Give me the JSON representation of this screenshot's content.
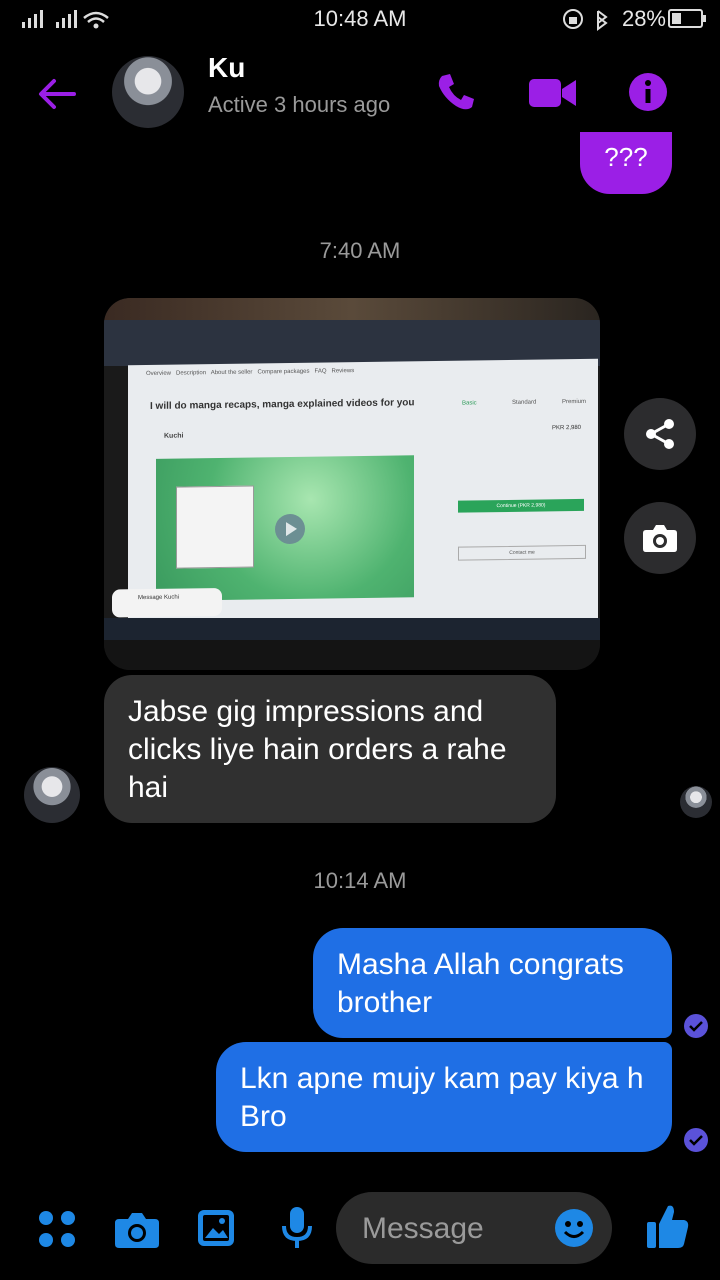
{
  "status_bar": {
    "time": "10:48 AM",
    "battery": "28%"
  },
  "header": {
    "name": "Ku",
    "presence": "Active 3 hours ago"
  },
  "messages": {
    "top_sent": "???",
    "time_1": "7:40 AM",
    "recv_1": "Jabse gig impressions and clicks liye hain orders a rahe hai",
    "time_2": "10:14 AM",
    "sent_1": "Masha Allah congrats brother",
    "sent_2": "Lkn apne mujy kam pay kiya h Bro"
  },
  "screenshot_content": {
    "gig_title": "I will do manga recaps, manga explained videos for you",
    "seller": "Kuchi",
    "tabs": [
      "Overview",
      "Description",
      "About the seller",
      "Compare packages",
      "FAQ",
      "Reviews"
    ],
    "package_tabs": [
      "Basic",
      "Standard",
      "Premium"
    ],
    "price": "PKR 2,980",
    "continue_label": "Continue (PKR 2,980)",
    "contact_label": "Contact me",
    "message_label": "Message Kuchi"
  },
  "composer": {
    "placeholder": "Message"
  },
  "colors": {
    "accent_purple": "#9b1fe6",
    "sent_blue": "#1f6fe5",
    "received_gray": "#303030",
    "icon_blue": "#1e88e5"
  }
}
